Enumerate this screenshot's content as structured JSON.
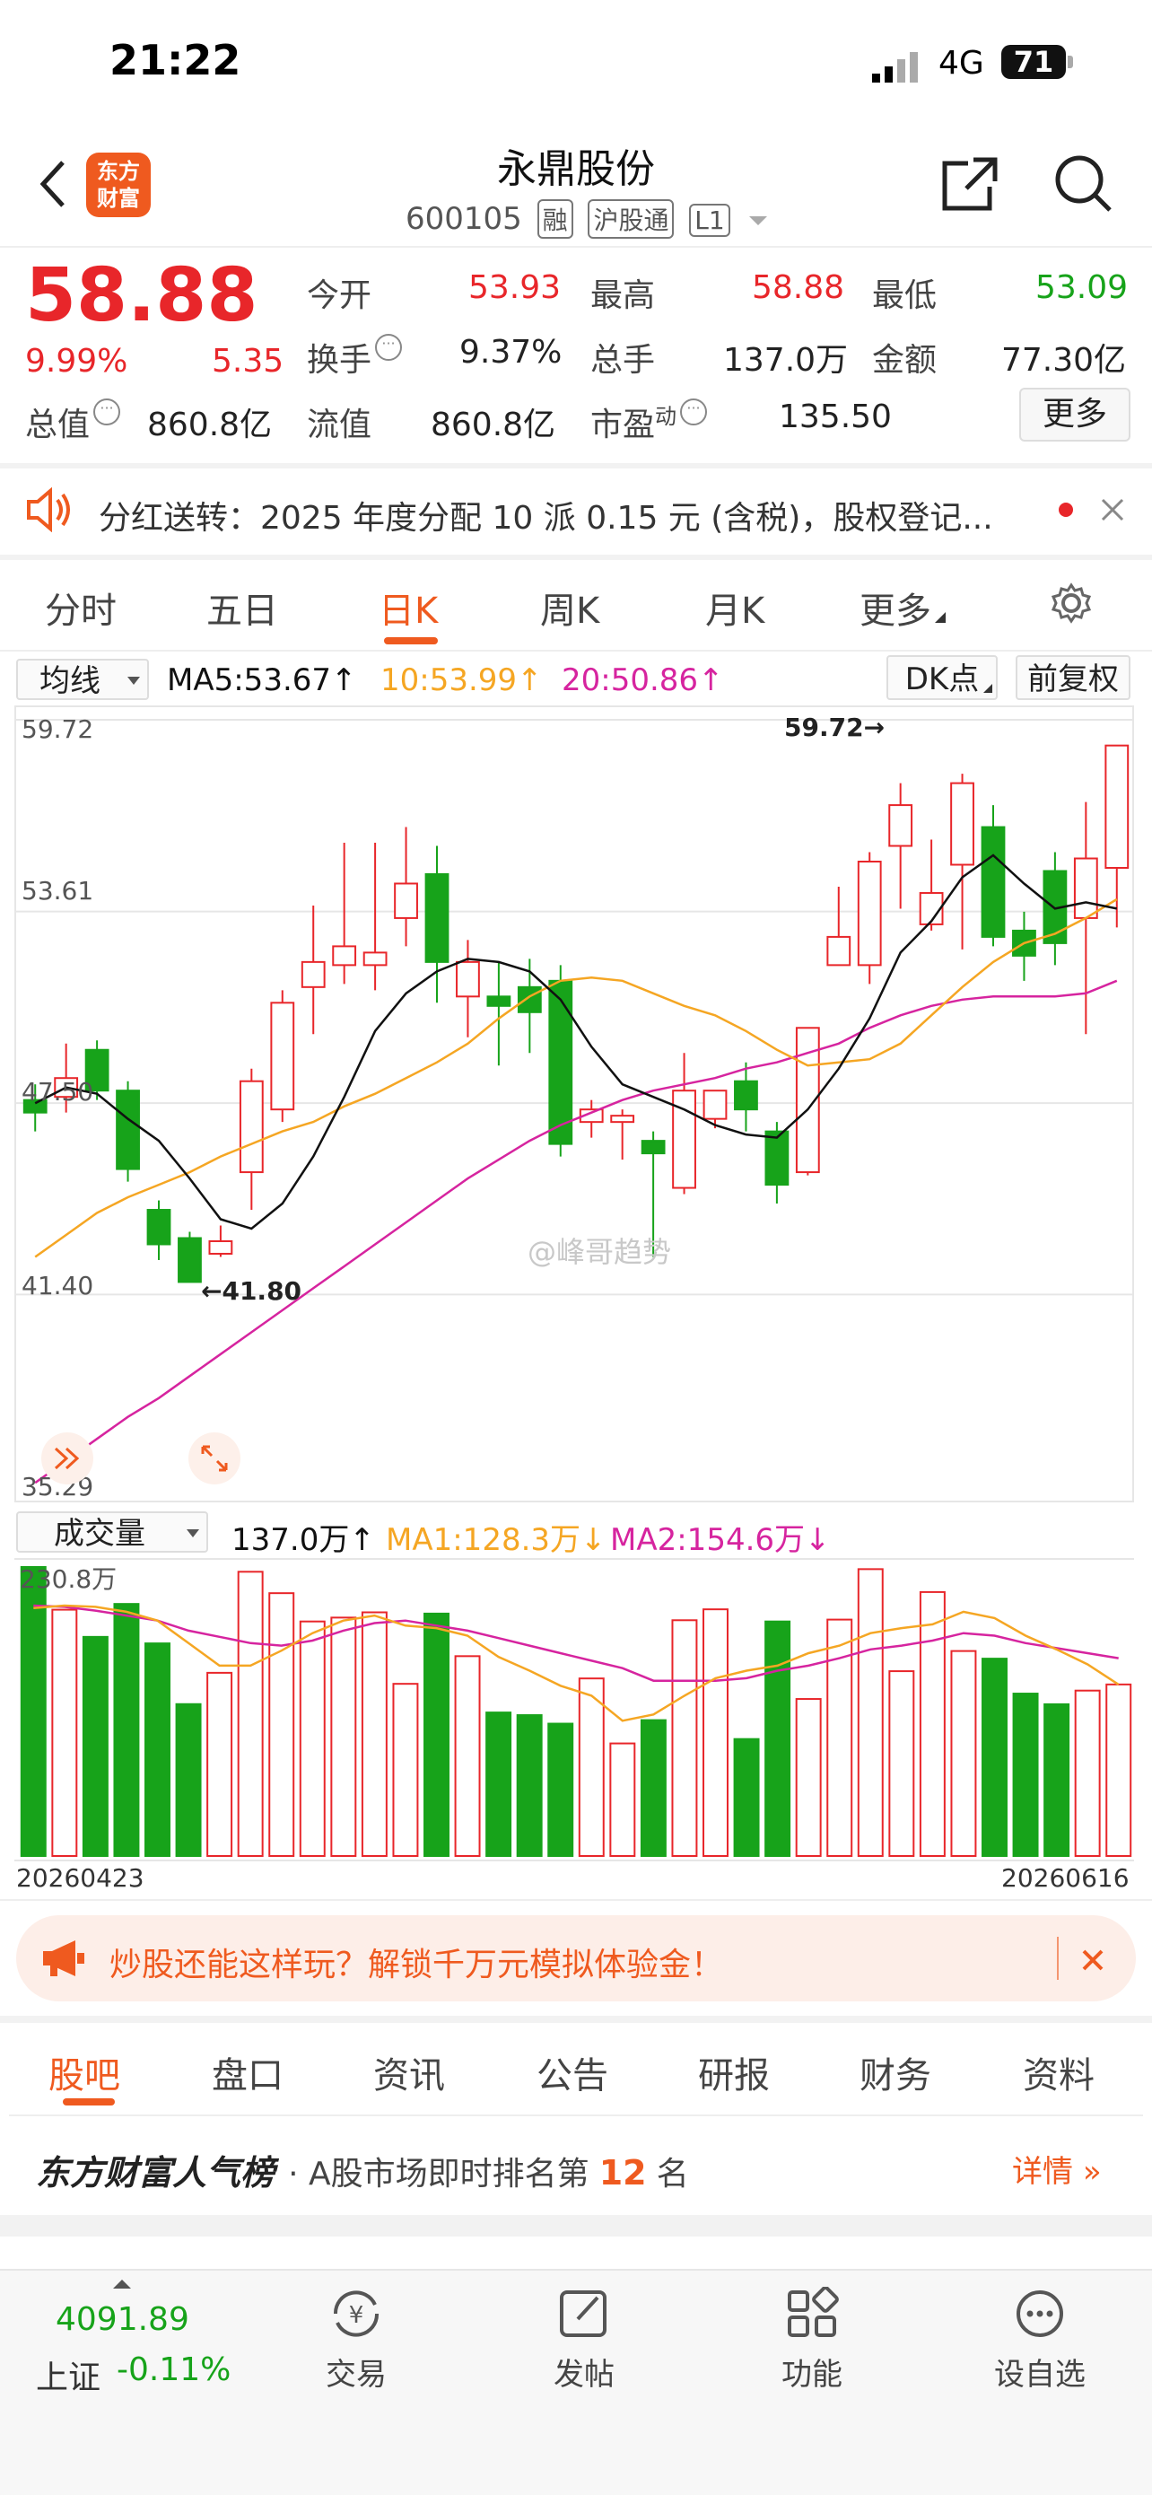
{
  "status_bar": {
    "time": "21:22",
    "network": "4G",
    "battery": "71"
  },
  "header": {
    "logo_text": "东方财富",
    "title": "永鼎股份",
    "code": "600105",
    "tags": [
      "融",
      "沪股通",
      "L1"
    ]
  },
  "quote": {
    "price": "58.88",
    "change_pct": "9.99%",
    "change": "5.35",
    "rows": [
      [
        {
          "label": "今开",
          "value": "53.93",
          "color": "red"
        },
        {
          "label": "最高",
          "value": "58.88",
          "color": "red"
        },
        {
          "label": "最低",
          "value": "53.09",
          "color": "green"
        }
      ],
      [
        {
          "label": "换手",
          "value": "9.37%",
          "color": "dark"
        },
        {
          "label": "总手",
          "value": "137.0万",
          "color": "dark"
        },
        {
          "label": "金额",
          "value": "77.30亿",
          "color": "dark"
        }
      ],
      [
        {
          "label": "总值",
          "value": "860.8亿",
          "color": "dark"
        },
        {
          "label": "流值",
          "value": "860.8亿",
          "color": "dark"
        },
        {
          "label": "市盈",
          "value": "135.50",
          "color": "dark",
          "sup": "动"
        }
      ]
    ],
    "more_label": "更多"
  },
  "notice": {
    "text": "分红送转：2025 年度分配 10 派 0.15 元 (含税)，股权登记..."
  },
  "tabs": [
    "分时",
    "五日",
    "日K",
    "周K",
    "月K",
    "更多"
  ],
  "active_tab": "日K",
  "ma_bar": {
    "selector": "均线",
    "ma5": "MA5:53.67",
    "ma10": "10:53.99",
    "ma20": "20:50.86",
    "dk": "DK点",
    "adjust": "前复权"
  },
  "colors": {
    "up": "#e8262a",
    "down": "#17a31a",
    "accent": "#ef5a1f",
    "ma5": "#111111",
    "ma10": "#f5a623",
    "ma20": "#d6249f"
  },
  "chart_data": {
    "type": "candlestick",
    "y_ticks": [
      "59.72",
      "53.61",
      "47.50",
      "41.40",
      "35.29"
    ],
    "ylim": [
      35.29,
      59.72
    ],
    "high_label": "59.72→",
    "low_label": "←41.80",
    "watermark": "@峰哥趋势",
    "candles": [
      {
        "o": 47.6,
        "c": 47.2,
        "h": 48.1,
        "l": 46.6
      },
      {
        "o": 47.7,
        "c": 48.3,
        "h": 49.4,
        "l": 47.2
      },
      {
        "o": 49.2,
        "c": 47.9,
        "h": 49.5,
        "l": 47.6
      },
      {
        "o": 47.9,
        "c": 45.4,
        "h": 48.2,
        "l": 45.0
      },
      {
        "o": 44.1,
        "c": 43.0,
        "h": 44.4,
        "l": 42.5
      },
      {
        "o": 43.2,
        "c": 41.8,
        "h": 43.4,
        "l": 41.8
      },
      {
        "o": 42.7,
        "c": 43.1,
        "h": 43.6,
        "l": 42.6
      },
      {
        "o": 45.3,
        "c": 48.2,
        "h": 48.6,
        "l": 44.1
      },
      {
        "o": 47.3,
        "c": 50.7,
        "h": 51.1,
        "l": 46.9
      },
      {
        "o": 51.2,
        "c": 52.0,
        "h": 53.8,
        "l": 49.7
      },
      {
        "o": 51.9,
        "c": 52.5,
        "h": 55.8,
        "l": 51.3
      },
      {
        "o": 51.9,
        "c": 52.3,
        "h": 55.8,
        "l": 51.1
      },
      {
        "o": 53.4,
        "c": 54.5,
        "h": 56.3,
        "l": 52.5
      },
      {
        "o": 54.8,
        "c": 52.0,
        "h": 55.7,
        "l": 50.7
      },
      {
        "o": 50.9,
        "c": 52.0,
        "h": 52.7,
        "l": 49.6
      },
      {
        "o": 50.9,
        "c": 50.6,
        "h": 52.0,
        "l": 48.7
      },
      {
        "o": 51.2,
        "c": 50.4,
        "h": 52.1,
        "l": 49.1
      },
      {
        "o": 51.4,
        "c": 46.2,
        "h": 51.9,
        "l": 45.8
      },
      {
        "o": 46.9,
        "c": 47.3,
        "h": 47.6,
        "l": 46.4
      },
      {
        "o": 46.9,
        "c": 47.1,
        "h": 47.3,
        "l": 45.7
      },
      {
        "o": 46.3,
        "c": 45.9,
        "h": 46.6,
        "l": 42.6
      },
      {
        "o": 44.8,
        "c": 47.9,
        "h": 49.1,
        "l": 44.6
      },
      {
        "o": 47.0,
        "c": 47.9,
        "h": 47.9,
        "l": 46.7
      },
      {
        "o": 48.2,
        "c": 47.3,
        "h": 48.8,
        "l": 46.6
      },
      {
        "o": 46.6,
        "c": 44.9,
        "h": 46.9,
        "l": 44.3
      },
      {
        "o": 45.3,
        "c": 49.9,
        "h": 49.9,
        "l": 45.2
      },
      {
        "o": 51.9,
        "c": 52.8,
        "h": 54.4,
        "l": 51.9
      },
      {
        "o": 51.9,
        "c": 55.2,
        "h": 55.5,
        "l": 51.3
      },
      {
        "o": 55.7,
        "c": 57.0,
        "h": 57.7,
        "l": 53.7
      },
      {
        "o": 53.2,
        "c": 54.2,
        "h": 55.9,
        "l": 53.0
      },
      {
        "o": 55.1,
        "c": 57.7,
        "h": 58.0,
        "l": 52.4
      },
      {
        "o": 56.3,
        "c": 52.8,
        "h": 57.0,
        "l": 52.5
      },
      {
        "o": 53.0,
        "c": 52.2,
        "h": 53.6,
        "l": 51.4
      },
      {
        "o": 54.9,
        "c": 52.6,
        "h": 55.5,
        "l": 51.9
      },
      {
        "o": 53.4,
        "c": 55.3,
        "h": 57.1,
        "l": 49.7
      },
      {
        "o": 55.0,
        "c": 58.9,
        "h": 58.9,
        "l": 53.1
      }
    ],
    "ma5": [
      47.5,
      48.0,
      47.8,
      47.0,
      46.3,
      45.1,
      43.8,
      43.5,
      44.3,
      45.8,
      47.7,
      49.8,
      51.0,
      51.7,
      52.1,
      52.0,
      51.7,
      50.8,
      49.3,
      48.1,
      47.7,
      47.3,
      46.8,
      46.5,
      46.4,
      47.3,
      48.6,
      50.2,
      52.3,
      53.3,
      54.7,
      55.4,
      54.5,
      53.7,
      53.9,
      53.7
    ],
    "ma10": [
      42.6,
      43.3,
      44.0,
      44.5,
      44.9,
      45.3,
      45.8,
      46.2,
      46.6,
      46.9,
      47.4,
      47.8,
      48.3,
      48.8,
      49.4,
      50.2,
      50.9,
      51.4,
      51.5,
      51.4,
      51.0,
      50.6,
      50.3,
      49.8,
      49.2,
      48.7,
      48.8,
      48.9,
      49.4,
      50.3,
      51.2,
      52.0,
      52.6,
      52.9,
      53.4,
      54.0
    ],
    "ma20": [
      35.4,
      36.1,
      36.8,
      37.5,
      38.1,
      38.8,
      39.5,
      40.2,
      40.9,
      41.6,
      42.3,
      43.0,
      43.7,
      44.4,
      45.1,
      45.7,
      46.3,
      46.8,
      47.2,
      47.6,
      47.9,
      48.1,
      48.3,
      48.6,
      48.8,
      49.1,
      49.4,
      49.9,
      50.3,
      50.6,
      50.8,
      50.9,
      50.9,
      50.9,
      51.0,
      51.4
    ],
    "volume": {
      "selector": "成交量",
      "current": "137.0万",
      "ma1": "MA1:128.3万",
      "ma2": "MA2:154.6万",
      "max_label": "230.8万",
      "ylim": [
        0,
        230.8
      ],
      "values": [
        230.8,
        196.7,
        175.0,
        201.3,
        169.8,
        121.3,
        146.3,
        227.0,
        209.9,
        187.3,
        190.4,
        194.6,
        137.5,
        193.6,
        159.6,
        114.6,
        112.5,
        105.7,
        141.8,
        89.9,
        108.5,
        188.3,
        197.0,
        93.4,
        187.3,
        125.4,
        188.8,
        229.1,
        147.6,
        210.8,
        163.7,
        157.6,
        129.7,
        121.2,
        132.1,
        137.0
      ],
      "ma1_line": [
        198,
        200,
        199,
        195,
        188,
        170,
        152,
        152,
        164,
        178,
        188,
        192,
        184,
        182,
        176,
        159,
        148,
        136,
        128,
        108,
        113,
        128,
        142,
        148,
        152,
        162,
        168,
        178,
        182,
        185,
        195,
        190,
        176,
        165,
        153,
        137
      ],
      "ma2_line": [
        200,
        199,
        196,
        192,
        188,
        180,
        175,
        170,
        168,
        172,
        180,
        186,
        188,
        184,
        180,
        174,
        168,
        162,
        156,
        150,
        140,
        140,
        140,
        142,
        148,
        152,
        158,
        165,
        168,
        172,
        178,
        176,
        170,
        166,
        162,
        158
      ]
    },
    "x_labels": [
      "20260423",
      "20260616"
    ]
  },
  "promo": {
    "text": "炒股还能这样玩？解锁千万元模拟体验金！"
  },
  "bottom_tabs": [
    "股吧",
    "盘口",
    "资讯",
    "公告",
    "研报",
    "财务",
    "资料"
  ],
  "ranking": {
    "brand": "东方财富人气榜",
    "text_prefix": "· A股市场即时排名第",
    "rank": "12",
    "text_suffix": "名",
    "detail": "详情"
  },
  "index": {
    "value": "4091.89",
    "name": "上证",
    "change": "-0.11%"
  },
  "nav": [
    {
      "label": "交易",
      "icon": "yuan-cycle-icon"
    },
    {
      "label": "发帖",
      "icon": "edit-icon"
    },
    {
      "label": "功能",
      "icon": "grid-icon"
    },
    {
      "label": "设自选",
      "icon": "more-dots-icon"
    }
  ]
}
